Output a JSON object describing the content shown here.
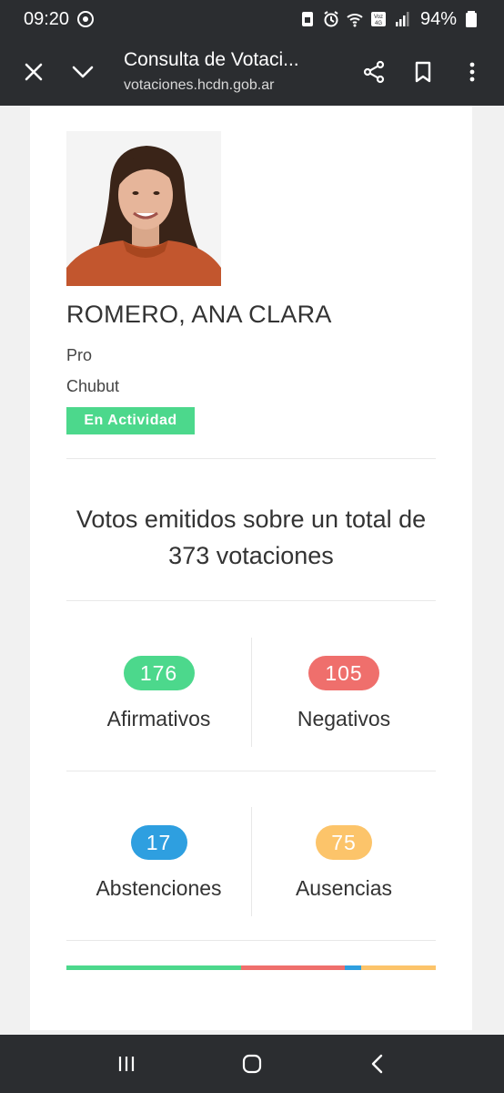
{
  "status_bar": {
    "time": "09:20",
    "battery": "94%",
    "network": "Voz 4G"
  },
  "toolbar": {
    "title": "Consulta de Votaci...",
    "url": "votaciones.hcdn.gob.ar"
  },
  "profile": {
    "name": "ROMERO, ANA CLARA",
    "party": "Pro",
    "district": "Chubut",
    "status": "En Actividad"
  },
  "summary": {
    "line1": "Votos emitidos sobre un total de",
    "line2": "373 votaciones"
  },
  "votes": {
    "afirmativos": {
      "count": "176",
      "label": "Afirmativos",
      "color": "#4cd88c"
    },
    "negativos": {
      "count": "105",
      "label": "Negativos",
      "color": "#ef6f6c"
    },
    "abstenciones": {
      "count": "17",
      "label": "Abstenciones",
      "color": "#2e9fe0"
    },
    "ausencias": {
      "count": "75",
      "label": "Ausencias",
      "color": "#fcc46a"
    }
  },
  "chart_data": {
    "type": "bar",
    "categories": [
      "Afirmativos",
      "Negativos",
      "Abstenciones",
      "Ausencias"
    ],
    "values": [
      176,
      105,
      17,
      75
    ],
    "colors": [
      "#4cd88c",
      "#ef6f6c",
      "#2e9fe0",
      "#fcc46a"
    ]
  }
}
